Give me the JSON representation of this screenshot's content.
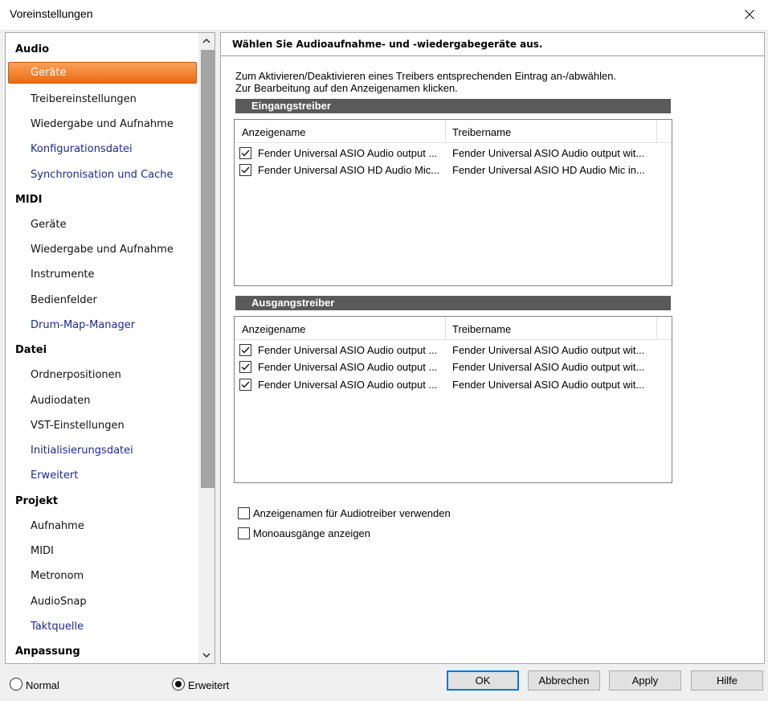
{
  "window": {
    "title": "Voreinstellungen"
  },
  "sidebar": {
    "groups": [
      {
        "label": "Audio",
        "items": [
          {
            "label": "Geräte",
            "selected": true
          },
          {
            "label": "Treibereinstellungen"
          },
          {
            "label": "Wiedergabe und Aufnahme"
          },
          {
            "label": "Konfigurationsdatei",
            "link": true
          },
          {
            "label": "Synchronisation und Cache",
            "link": true
          }
        ]
      },
      {
        "label": "MIDI",
        "items": [
          {
            "label": "Geräte"
          },
          {
            "label": "Wiedergabe und Aufnahme"
          },
          {
            "label": "Instrumente"
          },
          {
            "label": "Bedienfelder"
          },
          {
            "label": "Drum-Map-Manager",
            "link": true
          }
        ]
      },
      {
        "label": "Datei",
        "items": [
          {
            "label": "Ordnerpositionen"
          },
          {
            "label": "Audiodaten"
          },
          {
            "label": "VST-Einstellungen"
          },
          {
            "label": "Initialisierungsdatei",
            "link": true
          },
          {
            "label": "Erweitert",
            "link": true
          }
        ]
      },
      {
        "label": "Projekt",
        "items": [
          {
            "label": "Aufnahme"
          },
          {
            "label": "MIDI"
          },
          {
            "label": "Metronom"
          },
          {
            "label": "AudioSnap"
          },
          {
            "label": "Taktquelle",
            "link": true
          }
        ]
      },
      {
        "label": "Anpassung",
        "items": []
      }
    ]
  },
  "panel": {
    "header": "Wählen Sie Audioaufnahme- und -wiedergabegeräte aus.",
    "instruction_line1": "Zum Aktivieren/Deaktivieren eines Treibers entsprechenden Eintrag an-/abwählen.",
    "instruction_line2": "Zur Bearbeitung auf den Anzeigenamen klicken.",
    "input_section": {
      "title": "Eingangstreiber",
      "col_name": "Anzeigename",
      "col_driver": "Treibername",
      "rows": [
        {
          "name": "Fender Universal ASIO Audio output ...",
          "driver": "Fender Universal ASIO Audio output wit...",
          "checked": true
        },
        {
          "name": "Fender Universal ASIO HD Audio Mic...",
          "driver": "Fender Universal ASIO HD Audio Mic in...",
          "checked": true
        }
      ]
    },
    "output_section": {
      "title": "Ausgangstreiber",
      "col_name": "Anzeigename",
      "col_driver": "Treibername",
      "rows": [
        {
          "name": "Fender Universal ASIO Audio output ...",
          "driver": "Fender Universal ASIO Audio output wit...",
          "checked": true
        },
        {
          "name": "Fender Universal ASIO Audio output ...",
          "driver": "Fender Universal ASIO Audio output wit...",
          "checked": true
        },
        {
          "name": "Fender Universal ASIO Audio output ...",
          "driver": "Fender Universal ASIO Audio output wit...",
          "checked": true
        }
      ]
    },
    "option_display_names": {
      "label": "Anzeigenamen für Audiotreiber verwenden",
      "checked": false
    },
    "option_mono_outputs": {
      "label": "Monoausgänge anzeigen",
      "checked": false
    }
  },
  "footer": {
    "mode_normal": {
      "label": "Normal",
      "selected": false
    },
    "mode_advanced": {
      "label": "Erweitert",
      "selected": true
    },
    "ok_label": "OK",
    "cancel_label": "Abbrechen",
    "apply_label": "Apply",
    "help_label": "Hilfe"
  },
  "colors": {
    "selection_accent": "#ea6a12",
    "section_bar": "#5a5a5a",
    "link_text": "#1f2a8c",
    "default_button_border": "#0078d7"
  },
  "icons": {
    "close": "close-icon",
    "scroll_up": "chevron-up-icon",
    "scroll_down": "chevron-down-icon",
    "check": "checkmark-icon"
  }
}
